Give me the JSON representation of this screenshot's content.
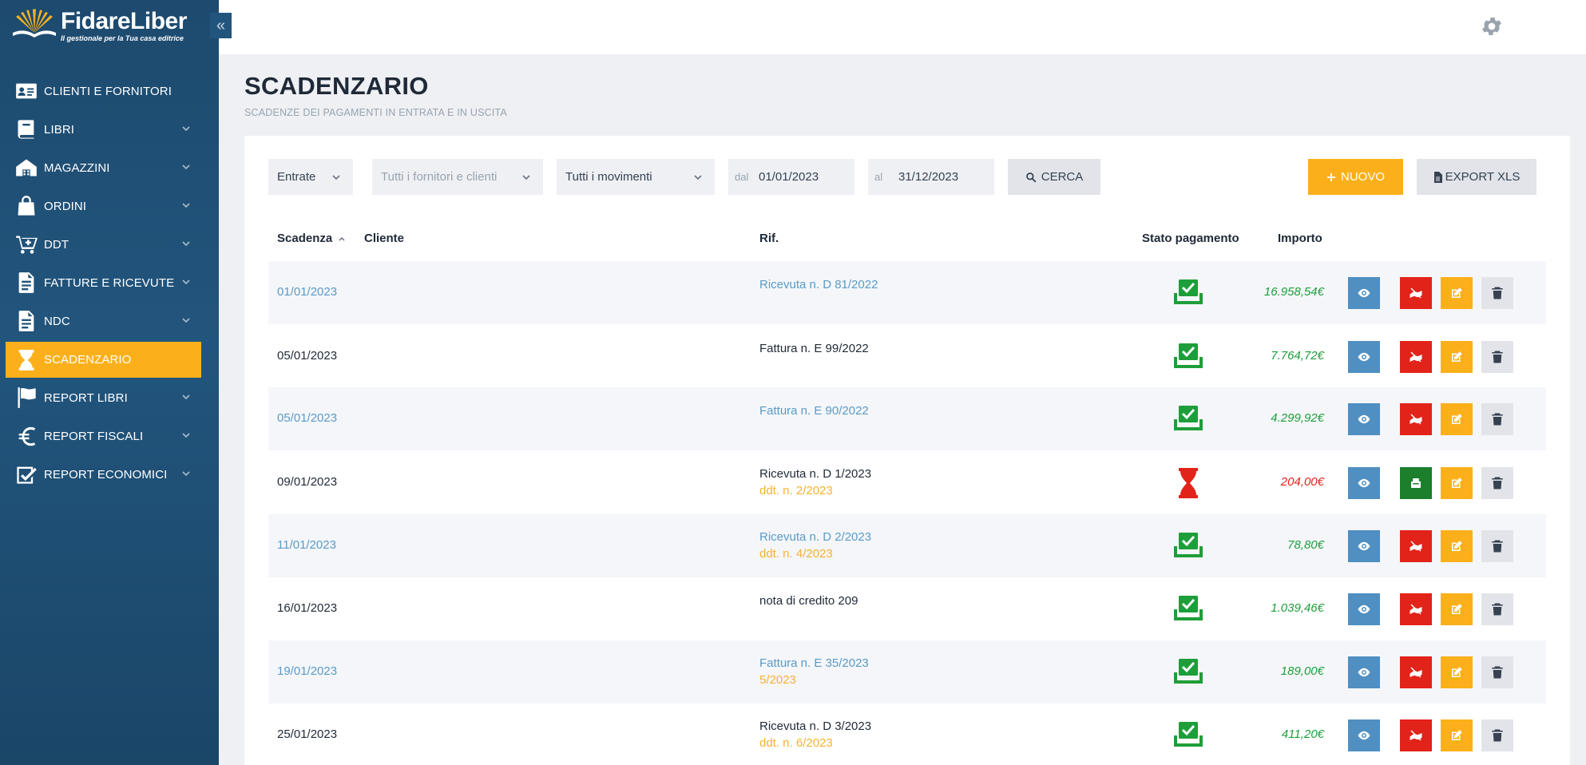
{
  "app": {
    "name": "FidareLiber",
    "tagline": "Il gestionale per la Tua casa editrice",
    "collapse_icon": "double-chevron-left-icon"
  },
  "sidebar": {
    "items": [
      {
        "label": "CLIENTI E FORNITORI",
        "icon": "contact-card-icon",
        "has_submenu": false,
        "active": false
      },
      {
        "label": "LIBRI",
        "icon": "book-icon",
        "has_submenu": true,
        "active": false
      },
      {
        "label": "MAGAZZINI",
        "icon": "warehouse-icon",
        "has_submenu": true,
        "active": false
      },
      {
        "label": "ORDINI",
        "icon": "shopping-bag-icon",
        "has_submenu": true,
        "active": false
      },
      {
        "label": "DDT",
        "icon": "cart-icon",
        "has_submenu": true,
        "active": false
      },
      {
        "label": "FATTURE E RICEVUTE",
        "icon": "document-icon",
        "has_submenu": true,
        "active": false
      },
      {
        "label": "NDC",
        "icon": "document-icon",
        "has_submenu": true,
        "active": false
      },
      {
        "label": "SCADENZARIO",
        "icon": "hourglass-icon",
        "has_submenu": false,
        "active": true
      },
      {
        "label": "REPORT LIBRI",
        "icon": "flag-icon",
        "has_submenu": true,
        "active": false
      },
      {
        "label": "REPORT FISCALI",
        "icon": "euro-icon",
        "has_submenu": true,
        "active": false
      },
      {
        "label": "REPORT ECONOMICI",
        "icon": "checkbox-icon",
        "has_submenu": true,
        "active": false
      }
    ]
  },
  "topbar": {
    "settings_icon": "gear-icon"
  },
  "page": {
    "title": "SCADENZARIO",
    "subtitle": "SCADENZE DEI PAGAMENTI IN ENTRATA E IN USCITA"
  },
  "filters": {
    "type": "Entrate",
    "party_placeholder": "Tutti i fornitori e clienti",
    "movements": "Tutti i movimenti",
    "from_label": "dal",
    "from_value": "01/01/2023",
    "to_label": "al",
    "to_value": "31/12/2023",
    "search_label": "CERCA",
    "new_label": "NUOVO",
    "export_label": "EXPORT XLS"
  },
  "table": {
    "headers": {
      "due": "Scadenza",
      "client": "Cliente",
      "ref": "Rif.",
      "status": "Stato pagamento",
      "amount": "Importo"
    },
    "sort_indicator": "sort-ascending-icon",
    "rows": [
      {
        "date": "01/01/2023",
        "ref": "Ricevuta n. D 81/2022",
        "ref2": "",
        "status": "paid",
        "amount": "16.958,54€"
      },
      {
        "date": "05/01/2023",
        "ref": "Fattura n. E 99/2022",
        "ref2": "",
        "status": "paid",
        "amount": "7.764,72€"
      },
      {
        "date": "05/01/2023",
        "ref": "Fattura n. E 90/2022",
        "ref2": "",
        "status": "paid",
        "amount": "4.299,92€"
      },
      {
        "date": "09/01/2023",
        "ref": "Ricevuta n. D 1/2023",
        "ref2": "ddt. n. 2/2023",
        "status": "pending",
        "amount": "204,00€"
      },
      {
        "date": "11/01/2023",
        "ref": "Ricevuta n. D 2/2023",
        "ref2": "ddt. n. 4/2023",
        "status": "paid",
        "amount": "78,80€"
      },
      {
        "date": "16/01/2023",
        "ref": "nota di credito 209",
        "ref2": "",
        "status": "paid",
        "amount": "1.039,46€"
      },
      {
        "date": "19/01/2023",
        "ref": "Fattura n. E 35/2023",
        "ref2": "5/2023",
        "status": "paid",
        "amount": "189,00€"
      },
      {
        "date": "25/01/2023",
        "ref": "Ricevuta n. D 3/2023",
        "ref2": "ddt. n. 6/2023",
        "status": "paid",
        "amount": "411,20€"
      }
    ]
  },
  "colors": {
    "sidebar": "#1d4a6e",
    "accent": "#fbb01b",
    "paid_green": "#1e9e3a",
    "pending_red": "#e2231a",
    "link_blue": "#5b9ac6"
  }
}
